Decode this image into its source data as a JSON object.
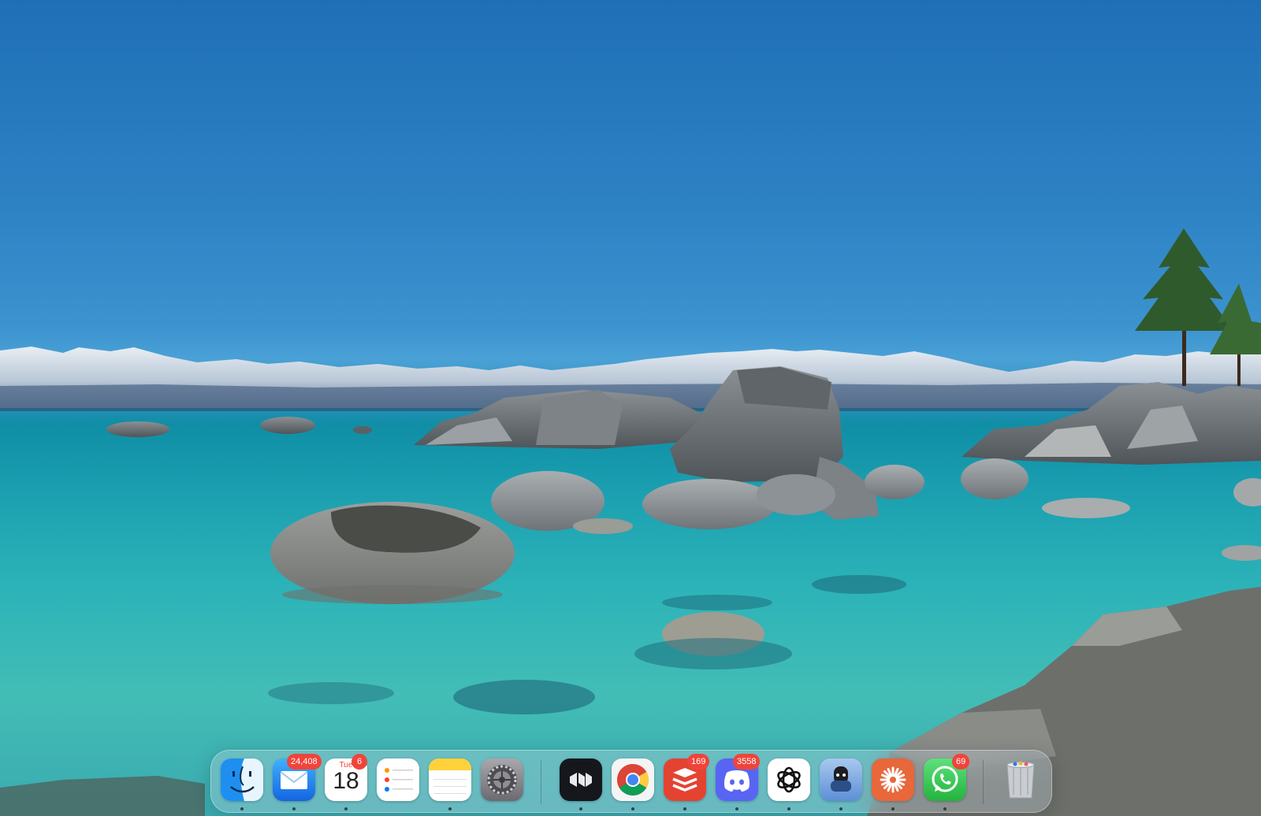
{
  "desktop": {
    "wallpaper": "lake-tahoe-boulders-wallpaper"
  },
  "dock": {
    "apps": [
      {
        "name": "Finder",
        "icon": "finder-icon",
        "running": true
      },
      {
        "name": "Mail",
        "icon": "mail-icon",
        "running": true,
        "badge": "24,408"
      },
      {
        "name": "Calendar",
        "icon": "calendar-icon",
        "running": true,
        "badge": "6",
        "day": "Tue",
        "date": "18"
      },
      {
        "name": "Reminders",
        "icon": "reminders-icon",
        "running": false
      },
      {
        "name": "Notes",
        "icon": "notes-icon",
        "running": true
      },
      {
        "name": "System Settings",
        "icon": "settings-icon",
        "running": false
      },
      {
        "name": "Linear",
        "icon": "linear-icon",
        "running": true
      },
      {
        "name": "Google Chrome",
        "icon": "chrome-icon",
        "running": true
      },
      {
        "name": "Todoist",
        "icon": "todoist-icon",
        "running": true,
        "badge": "169"
      },
      {
        "name": "Discord",
        "icon": "discord-icon",
        "running": true,
        "badge": "3558"
      },
      {
        "name": "ChatGPT",
        "icon": "chatgpt-icon",
        "running": true
      },
      {
        "name": "Ollama",
        "icon": "ollama-icon",
        "running": true
      },
      {
        "name": "Claude",
        "icon": "claude-icon",
        "running": true
      },
      {
        "name": "WhatsApp",
        "icon": "whatsapp-icon",
        "running": true,
        "badge": "69"
      },
      {
        "name": "Trash",
        "icon": "trash-icon",
        "running": false
      }
    ]
  },
  "colors": {
    "badge": "#f0443a",
    "sky": "#2d82c4",
    "water": "#2cb3b8"
  }
}
